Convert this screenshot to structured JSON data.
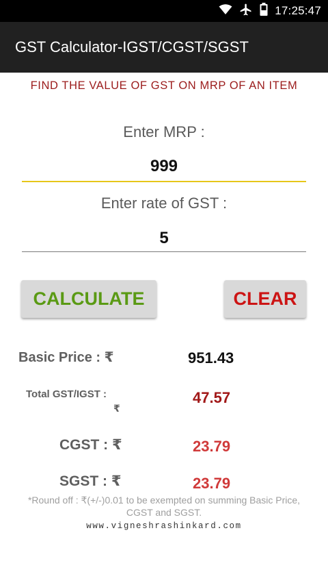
{
  "status_bar": {
    "time": "17:25:47",
    "icons": [
      "wifi-icon",
      "airplane-icon",
      "battery-icon"
    ]
  },
  "app_bar": {
    "title": "GST Calculator-IGST/CGST/SGST",
    "background": "#212121"
  },
  "headline": "FIND THE VALUE OF GST ON MRP OF AN ITEM",
  "form": {
    "mrp_label": "Enter MRP :",
    "mrp_value": "999",
    "gst_label": "Enter rate of GST :",
    "gst_value": "5"
  },
  "buttons": {
    "calculate_label": "CALCULATE",
    "clear_label": "CLEAR"
  },
  "results": {
    "basic_price_label": "Basic Price : ₹",
    "basic_price_value": "951.43",
    "total_gst_label": "Total GST/IGST :",
    "total_gst_currency": "₹",
    "total_gst_value": "47.57",
    "cgst_label": "CGST : ₹",
    "cgst_value": "23.79",
    "sgst_label": "SGST : ₹",
    "sgst_value": "23.79"
  },
  "footnote": "*Round off : ₹(+/-)0.01 to be exempted on summing Basic Price, CGST and SGST.",
  "website": "www.vigneshrashinkard.com",
  "colors": {
    "headline": "#9b1b1b",
    "calculate": "#5a9a14",
    "clear": "#cc1414",
    "total_gst": "#a11818",
    "cgst_sgst": "#d03a3a",
    "focused_underline": "#e6c619"
  }
}
